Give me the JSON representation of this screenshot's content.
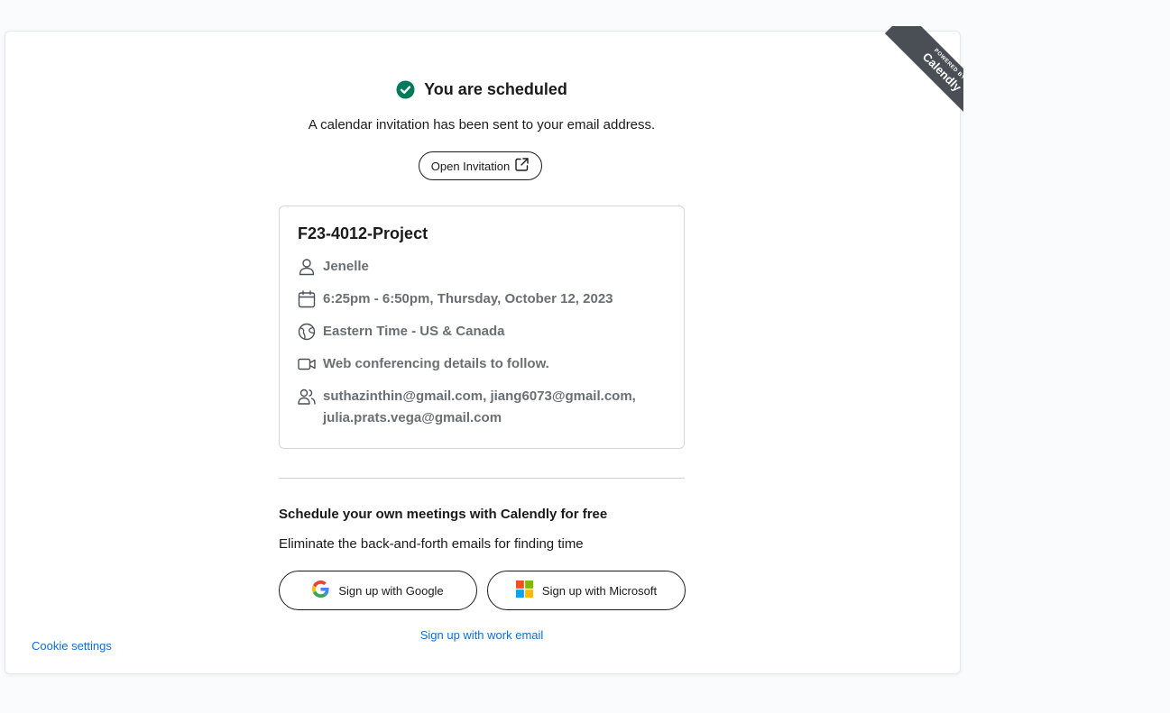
{
  "ribbon": {
    "small": "POWERED BY",
    "brand": "Calendly"
  },
  "confirmation": {
    "title": "You are scheduled",
    "subtitle": "A calendar invitation has been sent to your email address.",
    "open_invitation_label": "Open Invitation"
  },
  "event": {
    "name": "F23-4012-Project",
    "host": "Jenelle",
    "datetime": "6:25pm - 6:50pm, Thursday, October 12, 2023",
    "timezone": "Eastern Time - US & Canada",
    "location": "Web conferencing details to follow.",
    "guests_line1": "suthazinthin@gmail.com, jiang6073@gmail.com,",
    "guests_line2": "julia.prats.vega@gmail.com"
  },
  "promo": {
    "title": "Schedule your own meetings with Calendly for free",
    "subtitle": "Eliminate the back-and-forth emails for finding time",
    "google_label": "Sign up with Google",
    "microsoft_label": "Sign up with Microsoft",
    "work_email_label": "Sign up with work email"
  },
  "footer": {
    "cookie_settings": "Cookie settings"
  },
  "colors": {
    "success_green": "#007a5a",
    "link_blue": "#0b6fd6",
    "ribbon_gray": "#4a4f55",
    "detail_gray": "#6b6e72"
  }
}
